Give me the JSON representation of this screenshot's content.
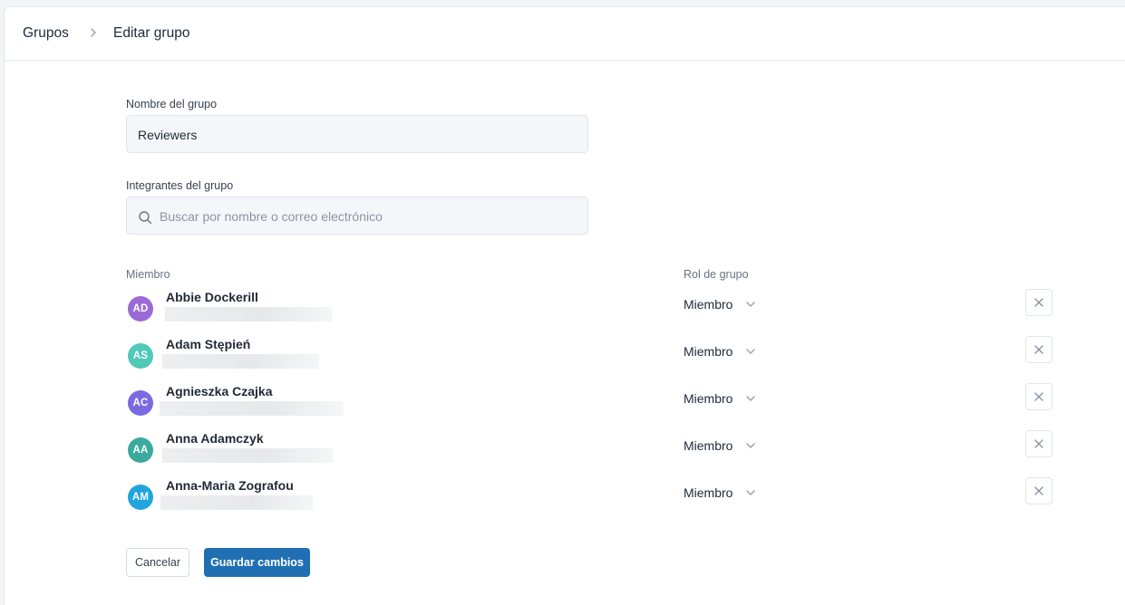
{
  "breadcrumb": {
    "root": "Grupos",
    "current": "Editar grupo"
  },
  "form": {
    "name_label": "Nombre del grupo",
    "name_value": "Reviewers",
    "members_label": "Integrantes del grupo",
    "search_placeholder": "Buscar por nombre o correo electrónico"
  },
  "table": {
    "col_member": "Miembro",
    "col_role": "Rol de grupo",
    "rows": [
      {
        "initials": "AD",
        "name": "Abbie Dockerill",
        "role": "Miembro",
        "avatar_color": "#9b6ad6"
      },
      {
        "initials": "AS",
        "name": "Adam Stępień",
        "role": "Miembro",
        "avatar_color": "#4fc9b8"
      },
      {
        "initials": "AC",
        "name": "Agnieszka Czajka",
        "role": "Miembro",
        "avatar_color": "#7a6ae0"
      },
      {
        "initials": "AA",
        "name": "Anna Adamczyk",
        "role": "Miembro",
        "avatar_color": "#3aaa9e"
      },
      {
        "initials": "AM",
        "name": "Anna-Maria Zografou",
        "role": "Miembro",
        "avatar_color": "#1fa5dc"
      }
    ]
  },
  "actions": {
    "cancel": "Cancelar",
    "save": "Guardar cambios"
  },
  "colors": {
    "primary": "#1f6fb2",
    "input_bg": "#f4f7fa"
  }
}
